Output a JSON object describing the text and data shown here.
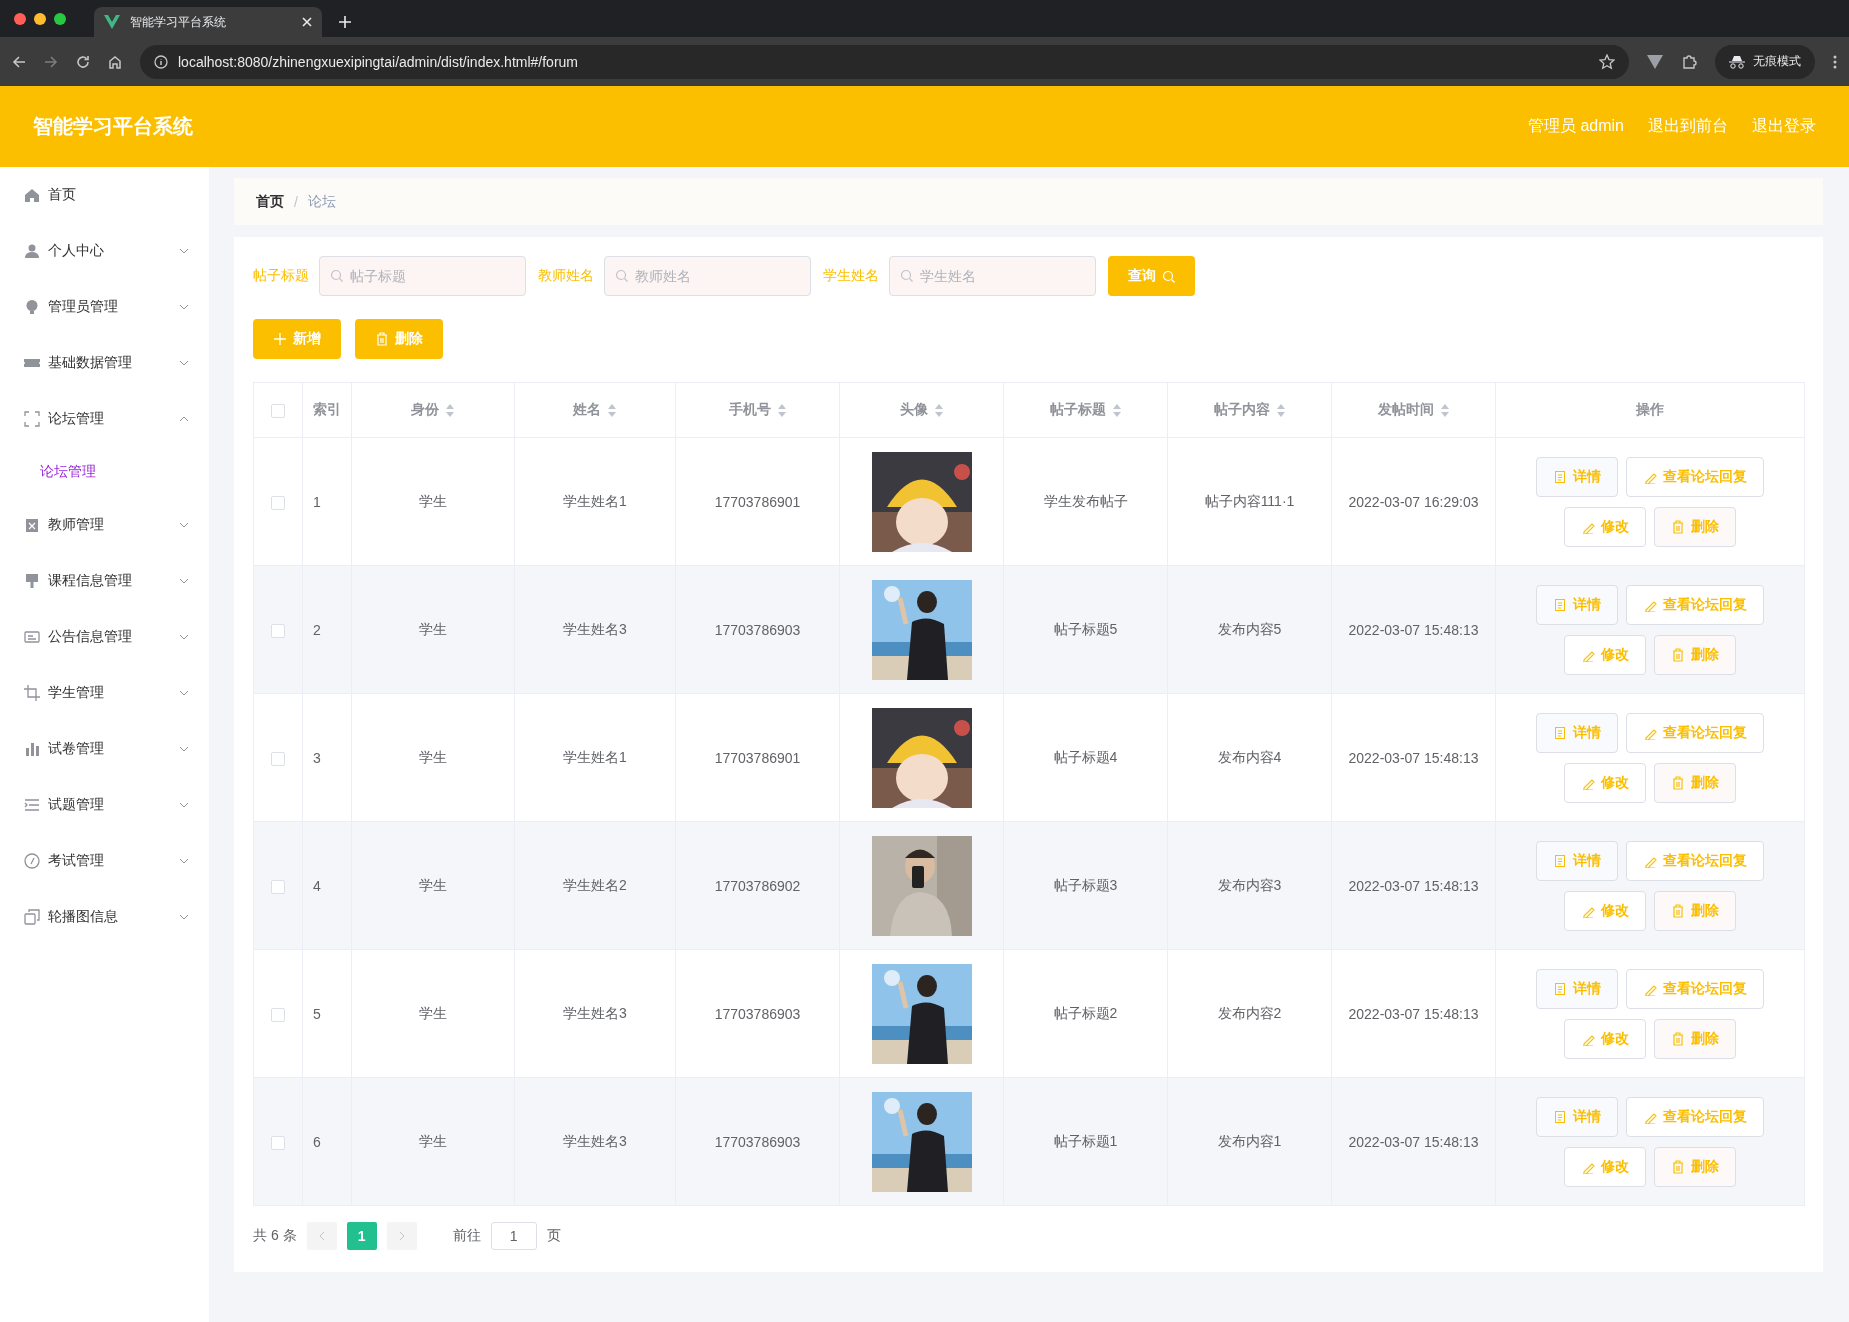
{
  "browser": {
    "tab_title": "智能学习平台系统",
    "url": "localhost:8080/zhinengxuexipingtai/admin/dist/index.html#/forum",
    "incognito_label": "无痕模式"
  },
  "header": {
    "title": "智能学习平台系统",
    "links": [
      "管理员 admin",
      "退出到前台",
      "退出登录"
    ]
  },
  "sidebar": {
    "items": [
      {
        "label": "首页"
      },
      {
        "label": "个人中心",
        "expanded": false
      },
      {
        "label": "管理员管理",
        "expanded": false
      },
      {
        "label": "基础数据管理",
        "expanded": false
      },
      {
        "label": "论坛管理",
        "expanded": true,
        "children": [
          {
            "label": "论坛管理",
            "selected": true
          }
        ]
      },
      {
        "label": "教师管理",
        "expanded": false
      },
      {
        "label": "课程信息管理",
        "expanded": false
      },
      {
        "label": "公告信息管理",
        "expanded": false
      },
      {
        "label": "学生管理",
        "expanded": false
      },
      {
        "label": "试卷管理",
        "expanded": false
      },
      {
        "label": "试题管理",
        "expanded": false
      },
      {
        "label": "考试管理",
        "expanded": false
      },
      {
        "label": "轮播图信息",
        "expanded": false
      }
    ]
  },
  "breadcrumb": {
    "items": [
      "首页",
      "论坛"
    ],
    "separator": "/"
  },
  "search": {
    "fields": [
      {
        "label": "帖子标题",
        "placeholder": "帖子标题"
      },
      {
        "label": "教师姓名",
        "placeholder": "教师姓名"
      },
      {
        "label": "学生姓名",
        "placeholder": "学生姓名"
      }
    ],
    "button": "查询"
  },
  "toolbar": [
    {
      "kind": "add",
      "label": "新增"
    },
    {
      "kind": "delete",
      "label": "删除"
    }
  ],
  "table": {
    "select_all": {
      "checked": false
    },
    "columns": [
      {
        "label": "索引",
        "sortable": false
      },
      {
        "label": "身份",
        "sortable": true
      },
      {
        "label": "姓名",
        "sortable": true
      },
      {
        "label": "手机号",
        "sortable": true
      },
      {
        "label": "头像",
        "sortable": true
      },
      {
        "label": "帖子标题",
        "sortable": true
      },
      {
        "label": "帖子内容",
        "sortable": true
      },
      {
        "label": "发帖时间",
        "sortable": true
      },
      {
        "label": "操作",
        "sortable": false
      }
    ],
    "rows": [
      {
        "checked": false,
        "index": "1",
        "role": "学生",
        "name": "学生姓名1",
        "phone": "17703786901",
        "title": "学生发布帖子",
        "content": "帖子内容111·1",
        "time": "2022-03-07 16:29:03",
        "actions": [
          {
            "kind": "detail",
            "label": "详情"
          },
          {
            "kind": "reply",
            "label": "查看论坛回复"
          },
          {
            "kind": "edit",
            "label": "修改"
          },
          {
            "kind": "delete",
            "label": "删除"
          }
        ]
      },
      {
        "checked": false,
        "index": "2",
        "role": "学生",
        "name": "学生姓名3",
        "phone": "17703786903",
        "title": "帖子标题5",
        "content": "发布内容5",
        "time": "2022-03-07 15:48:13",
        "actions": [
          {
            "kind": "detail",
            "label": "详情"
          },
          {
            "kind": "reply",
            "label": "查看论坛回复"
          },
          {
            "kind": "edit",
            "label": "修改"
          },
          {
            "kind": "delete",
            "label": "删除"
          }
        ]
      },
      {
        "checked": false,
        "index": "3",
        "role": "学生",
        "name": "学生姓名1",
        "phone": "17703786901",
        "title": "帖子标题4",
        "content": "发布内容4",
        "time": "2022-03-07 15:48:13",
        "actions": [
          {
            "kind": "detail",
            "label": "详情"
          },
          {
            "kind": "reply",
            "label": "查看论坛回复"
          },
          {
            "kind": "edit",
            "label": "修改"
          },
          {
            "kind": "delete",
            "label": "删除"
          }
        ]
      },
      {
        "checked": false,
        "index": "4",
        "role": "学生",
        "name": "学生姓名2",
        "phone": "17703786902",
        "title": "帖子标题3",
        "content": "发布内容3",
        "time": "2022-03-07 15:48:13",
        "actions": [
          {
            "kind": "detail",
            "label": "详情"
          },
          {
            "kind": "reply",
            "label": "查看论坛回复"
          },
          {
            "kind": "edit",
            "label": "修改"
          },
          {
            "kind": "delete",
            "label": "删除"
          }
        ]
      },
      {
        "checked": false,
        "index": "5",
        "role": "学生",
        "name": "学生姓名3",
        "phone": "17703786903",
        "title": "帖子标题2",
        "content": "发布内容2",
        "time": "2022-03-07 15:48:13",
        "actions": [
          {
            "kind": "detail",
            "label": "详情"
          },
          {
            "kind": "reply",
            "label": "查看论坛回复"
          },
          {
            "kind": "edit",
            "label": "修改"
          },
          {
            "kind": "delete",
            "label": "删除"
          }
        ]
      },
      {
        "checked": false,
        "index": "6",
        "role": "学生",
        "name": "学生姓名3",
        "phone": "17703786903",
        "title": "帖子标题1",
        "content": "发布内容1",
        "time": "2022-03-07 15:48:13",
        "actions": [
          {
            "kind": "detail",
            "label": "详情"
          },
          {
            "kind": "reply",
            "label": "查看论坛回复"
          },
          {
            "kind": "edit",
            "label": "修改"
          },
          {
            "kind": "delete",
            "label": "删除"
          }
        ]
      }
    ]
  },
  "pagination": {
    "total": "共 6 条",
    "prev_disabled": true,
    "next_disabled": true,
    "pages": [
      {
        "label": "1",
        "selected": true
      }
    ],
    "goto_label": "前往",
    "goto_value": "1",
    "goto_suffix": "页"
  }
}
